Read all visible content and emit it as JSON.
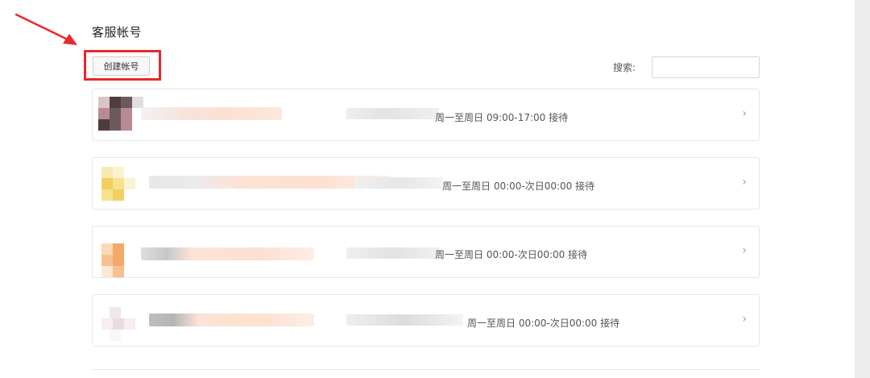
{
  "page": {
    "title": "客服帐号"
  },
  "toolbar": {
    "create_label": "创建帐号",
    "search_label": "搜索:",
    "search_value": "",
    "search_placeholder": ""
  },
  "accounts": [
    {
      "schedule": "周一至周日 09:00-17:00 接待",
      "avatar_colors": [
        "#b88a94",
        "#4f3c40",
        "#6b5a5d",
        "#d9c4c8"
      ]
    },
    {
      "schedule": "周一至周日 00:00-次日00:00 接待",
      "avatar_colors": [
        "#f6e28c",
        "#f1d060",
        "#f7eab0",
        "#fbf3d0"
      ]
    },
    {
      "schedule": "周一至周日 00:00-次日00:00 接待",
      "avatar_colors": [
        "#f4a96b",
        "#f7c18f",
        "#fbd9b8",
        "#fde8d4"
      ]
    },
    {
      "schedule": "周一至周日 00:00-次日00:00 接待",
      "avatar_colors": [
        "#e8dce0",
        "#f1e6e9",
        "#f6eef0",
        "#faf5f6"
      ]
    }
  ],
  "colors": {
    "annotation_red": "#e8282b",
    "border": "#e6e6e6",
    "name_blur": "#fde3d6",
    "id_blur": "#e5e5e5"
  }
}
